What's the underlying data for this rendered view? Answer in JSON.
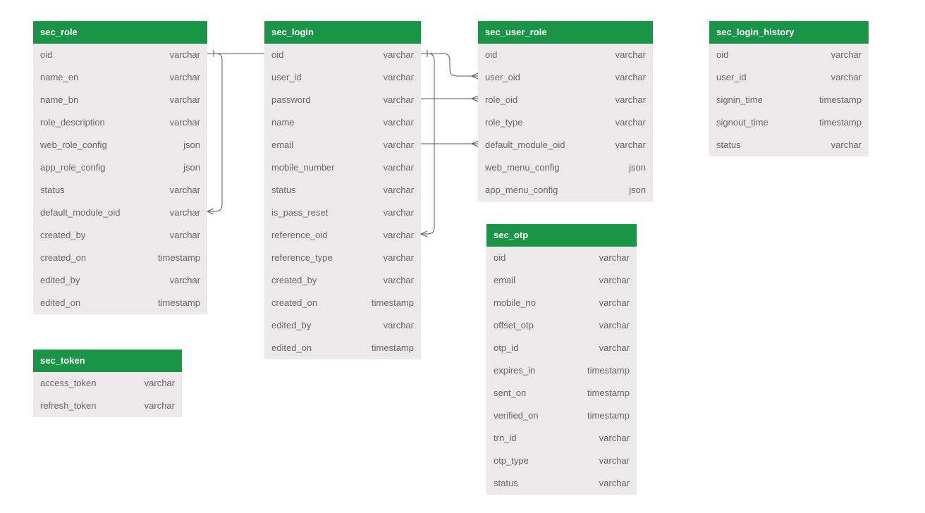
{
  "tables": {
    "role": {
      "title": "sec_role",
      "columns": [
        {
          "name": "oid",
          "type": "varchar"
        },
        {
          "name": "name_en",
          "type": "varchar"
        },
        {
          "name": "name_bn",
          "type": "varchar"
        },
        {
          "name": "role_description",
          "type": "varchar"
        },
        {
          "name": "web_role_config",
          "type": "json"
        },
        {
          "name": "app_role_config",
          "type": "json"
        },
        {
          "name": "status",
          "type": "varchar"
        },
        {
          "name": "default_module_oid",
          "type": "varchar"
        },
        {
          "name": "created_by",
          "type": "varchar"
        },
        {
          "name": "created_on",
          "type": "timestamp"
        },
        {
          "name": "edited_by",
          "type": "varchar"
        },
        {
          "name": "edited_on",
          "type": "timestamp"
        }
      ]
    },
    "login": {
      "title": "sec_login",
      "columns": [
        {
          "name": "oid",
          "type": "varchar"
        },
        {
          "name": "user_id",
          "type": "varchar"
        },
        {
          "name": "password",
          "type": "varchar"
        },
        {
          "name": "name",
          "type": "varchar"
        },
        {
          "name": "email",
          "type": "varchar"
        },
        {
          "name": "mobile_number",
          "type": "varchar"
        },
        {
          "name": "status",
          "type": "varchar"
        },
        {
          "name": "is_pass_reset",
          "type": "varchar"
        },
        {
          "name": "reference_oid",
          "type": "varchar"
        },
        {
          "name": "reference_type",
          "type": "varchar"
        },
        {
          "name": "created_by",
          "type": "varchar"
        },
        {
          "name": "created_on",
          "type": "timestamp"
        },
        {
          "name": "edited_by",
          "type": "varchar"
        },
        {
          "name": "edited_on",
          "type": "timestamp"
        }
      ]
    },
    "user_role": {
      "title": "sec_user_role",
      "columns": [
        {
          "name": "oid",
          "type": "varchar"
        },
        {
          "name": "user_oid",
          "type": "varchar"
        },
        {
          "name": "role_oid",
          "type": "varchar"
        },
        {
          "name": "role_type",
          "type": "varchar"
        },
        {
          "name": "default_module_oid",
          "type": "varchar"
        },
        {
          "name": "web_menu_config",
          "type": "json"
        },
        {
          "name": "app_menu_config",
          "type": "json"
        }
      ]
    },
    "login_history": {
      "title": "sec_login_history",
      "columns": [
        {
          "name": "oid",
          "type": "varchar"
        },
        {
          "name": "user_id",
          "type": "varchar"
        },
        {
          "name": "signin_time",
          "type": "timestamp"
        },
        {
          "name": "signout_time",
          "type": "timestamp"
        },
        {
          "name": "status",
          "type": "varchar"
        }
      ]
    },
    "token": {
      "title": "sec_token",
      "columns": [
        {
          "name": "access_token",
          "type": "varchar"
        },
        {
          "name": "refresh_token",
          "type": "varchar"
        }
      ]
    },
    "otp": {
      "title": "sec_otp",
      "columns": [
        {
          "name": "oid",
          "type": "varchar"
        },
        {
          "name": "email",
          "type": "varchar"
        },
        {
          "name": "mobile_no",
          "type": "varchar"
        },
        {
          "name": "offset_otp",
          "type": "varchar"
        },
        {
          "name": "otp_id",
          "type": "varchar"
        },
        {
          "name": "expires_in",
          "type": "timestamp"
        },
        {
          "name": "sent_on",
          "type": "timestamp"
        },
        {
          "name": "verified_on",
          "type": "timestamp"
        },
        {
          "name": "trn_id",
          "type": "varchar"
        },
        {
          "name": "otp_type",
          "type": "varchar"
        },
        {
          "name": "status",
          "type": "varchar"
        }
      ]
    }
  },
  "colors": {
    "header_bg": "#1a9446",
    "header_text": "#ffffff",
    "row_bg": "#ebe9ea",
    "row_text": "#666666",
    "line": "#555555"
  }
}
